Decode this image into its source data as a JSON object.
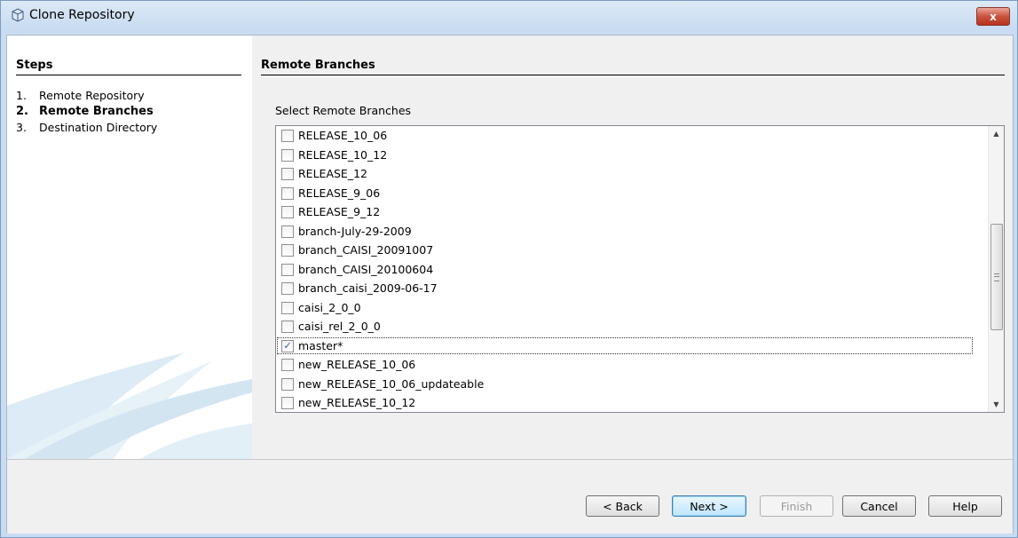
{
  "window": {
    "title": "Clone Repository",
    "close_label": "x"
  },
  "steps": {
    "header": "Steps",
    "items": [
      {
        "num": "1.",
        "label": "Remote Repository",
        "active": false
      },
      {
        "num": "2.",
        "label": "Remote Branches",
        "active": true
      },
      {
        "num": "3.",
        "label": "Destination Directory",
        "active": false
      }
    ]
  },
  "main": {
    "header": "Remote Branches",
    "select_label": "Select Remote Branches",
    "branches": [
      {
        "name": "RELEASE_10_06",
        "checked": false
      },
      {
        "name": "RELEASE_10_12",
        "checked": false
      },
      {
        "name": "RELEASE_12",
        "checked": false
      },
      {
        "name": "RELEASE_9_06",
        "checked": false
      },
      {
        "name": "RELEASE_9_12",
        "checked": false
      },
      {
        "name": "branch-July-29-2009",
        "checked": false
      },
      {
        "name": "branch_CAISI_20091007",
        "checked": false
      },
      {
        "name": "branch_CAISI_20100604",
        "checked": false
      },
      {
        "name": "branch_caisi_2009-06-17",
        "checked": false
      },
      {
        "name": "caisi_2_0_0",
        "checked": false
      },
      {
        "name": "caisi_rel_2_0_0",
        "checked": false
      },
      {
        "name": "master*",
        "checked": true
      },
      {
        "name": "new_RELEASE_10_06",
        "checked": false
      },
      {
        "name": "new_RELEASE_10_06_updateable",
        "checked": false
      },
      {
        "name": "new_RELEASE_10_12",
        "checked": false
      }
    ]
  },
  "buttons": {
    "back": "< Back",
    "next": "Next >",
    "finish": "Finish",
    "cancel": "Cancel",
    "help": "Help"
  },
  "icons": {
    "checkbox_checked": "✓"
  }
}
